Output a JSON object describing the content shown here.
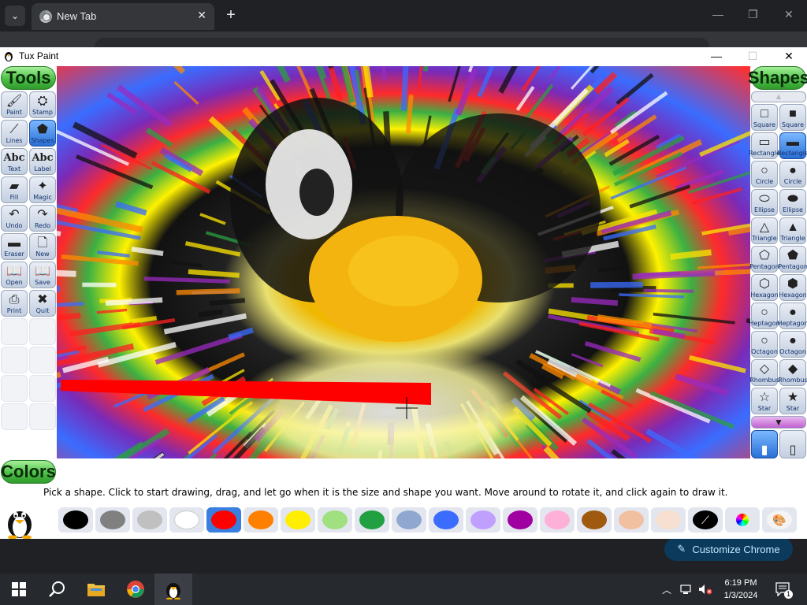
{
  "browser": {
    "tab_title": "New Tab",
    "new_tab": "+",
    "close_tab": "✕",
    "minimize": "—",
    "restore": "❐",
    "close": "✕",
    "customize_label": "Customize Chrome"
  },
  "window": {
    "title": "Tux Paint",
    "minimize": "—",
    "maximize": "☐",
    "close": "✕"
  },
  "tools": {
    "heading": "Tools",
    "items": [
      {
        "label": "Paint",
        "icon": "paintbrush-icon",
        "glyph": "🖌"
      },
      {
        "label": "Stamp",
        "icon": "stamp-icon",
        "glyph": "⛭"
      },
      {
        "label": "Lines",
        "icon": "lines-icon",
        "glyph": "⟋"
      },
      {
        "label": "Shapes",
        "icon": "shapes-icon",
        "glyph": "⬟",
        "selected": true
      },
      {
        "label": "Text",
        "icon": "text-icon",
        "glyph": "Abc"
      },
      {
        "label": "Label",
        "icon": "label-icon",
        "glyph": "Abc"
      },
      {
        "label": "Fill",
        "icon": "fill-bucket-icon",
        "glyph": "▰"
      },
      {
        "label": "Magic",
        "icon": "magic-wand-icon",
        "glyph": "✦"
      },
      {
        "label": "Undo",
        "icon": "undo-icon",
        "glyph": "↶"
      },
      {
        "label": "Redo",
        "icon": "redo-icon",
        "glyph": "↷"
      },
      {
        "label": "Eraser",
        "icon": "eraser-icon",
        "glyph": "▬"
      },
      {
        "label": "New",
        "icon": "new-page-icon",
        "glyph": "🗋"
      },
      {
        "label": "Open",
        "icon": "open-book-icon",
        "glyph": "📖"
      },
      {
        "label": "Save",
        "icon": "save-icon",
        "glyph": "📖"
      },
      {
        "label": "Print",
        "icon": "printer-icon",
        "glyph": "⎙"
      },
      {
        "label": "Quit",
        "icon": "quit-icon",
        "glyph": "✖"
      }
    ]
  },
  "shapes": {
    "heading": "Shapes",
    "scroll_up": "▲",
    "scroll_down": "▼",
    "items": [
      {
        "label": "Square",
        "icon": "square-outline-icon",
        "glyph": "□"
      },
      {
        "label": "Square",
        "icon": "square-filled-icon",
        "glyph": "■"
      },
      {
        "label": "Rectangle",
        "icon": "rectangle-outline-icon",
        "glyph": "▭"
      },
      {
        "label": "Rectangle",
        "icon": "rectangle-filled-icon",
        "glyph": "▬",
        "selected": true
      },
      {
        "label": "Circle",
        "icon": "circle-outline-icon",
        "glyph": "○"
      },
      {
        "label": "Circle",
        "icon": "circle-filled-icon",
        "glyph": "●"
      },
      {
        "label": "Ellipse",
        "icon": "ellipse-outline-icon",
        "glyph": "⬭"
      },
      {
        "label": "Ellipse",
        "icon": "ellipse-filled-icon",
        "glyph": "⬬"
      },
      {
        "label": "Triangle",
        "icon": "triangle-outline-icon",
        "glyph": "△"
      },
      {
        "label": "Triangle",
        "icon": "triangle-filled-icon",
        "glyph": "▲"
      },
      {
        "label": "Pentagon",
        "icon": "pentagon-outline-icon",
        "glyph": "⬠"
      },
      {
        "label": "Pentagon",
        "icon": "pentagon-filled-icon",
        "glyph": "⬟"
      },
      {
        "label": "Hexagon",
        "icon": "hexagon-outline-icon",
        "glyph": "⬡"
      },
      {
        "label": "Hexagon",
        "icon": "hexagon-filled-icon",
        "glyph": "⬢"
      },
      {
        "label": "Heptagon",
        "icon": "heptagon-outline-icon",
        "glyph": "○"
      },
      {
        "label": "Heptagon",
        "icon": "heptagon-filled-icon",
        "glyph": "●"
      },
      {
        "label": "Octagon",
        "icon": "octagon-outline-icon",
        "glyph": "○"
      },
      {
        "label": "Octagon",
        "icon": "octagon-filled-icon",
        "glyph": "●"
      },
      {
        "label": "Rhombus",
        "icon": "rhombus-outline-icon",
        "glyph": "◇"
      },
      {
        "label": "Rhombus",
        "icon": "rhombus-filled-icon",
        "glyph": "◆"
      },
      {
        "label": "Star",
        "icon": "star-outline-icon",
        "glyph": "☆"
      },
      {
        "label": "Star",
        "icon": "star-filled-icon",
        "glyph": "★"
      }
    ]
  },
  "colors": {
    "heading": "Colors",
    "swatches": [
      {
        "name": "black",
        "hex": "#000000"
      },
      {
        "name": "dark-gray",
        "hex": "#808080"
      },
      {
        "name": "light-gray",
        "hex": "#c0c0c0"
      },
      {
        "name": "white",
        "hex": "#ffffff"
      },
      {
        "name": "red",
        "hex": "#ff0000",
        "selected": true
      },
      {
        "name": "orange",
        "hex": "#ff8000"
      },
      {
        "name": "yellow",
        "hex": "#ffee00"
      },
      {
        "name": "light-green",
        "hex": "#a0e080"
      },
      {
        "name": "green",
        "hex": "#20a040"
      },
      {
        "name": "sky-blue",
        "hex": "#90a8d0"
      },
      {
        "name": "blue",
        "hex": "#3a6cff"
      },
      {
        "name": "lavender",
        "hex": "#c0a0ff"
      },
      {
        "name": "purple",
        "hex": "#a000a0"
      },
      {
        "name": "pink",
        "hex": "#ffb0d8"
      },
      {
        "name": "brown",
        "hex": "#a05a10"
      },
      {
        "name": "tan",
        "hex": "#f0c0a0"
      },
      {
        "name": "beige",
        "hex": "#f8e0d0"
      }
    ],
    "special": [
      {
        "name": "color-picker",
        "icon": "eyedropper-icon"
      },
      {
        "name": "rainbow-palette",
        "icon": "rainbow-palette-icon"
      },
      {
        "name": "color-mixer",
        "icon": "palette-icon"
      }
    ]
  },
  "status_text": "Pick a shape. Click to start drawing, drag, and let go when it is the size and shape you want. Move around to rotate it, and click again to draw it.",
  "taskbar": {
    "start": "windows-start-icon",
    "search": "search-icon",
    "apps": [
      "file-explorer-icon",
      "chrome-icon",
      "tux-paint-icon"
    ],
    "time": "6:19 PM",
    "date": "1/3/2024",
    "notifications": "1"
  }
}
